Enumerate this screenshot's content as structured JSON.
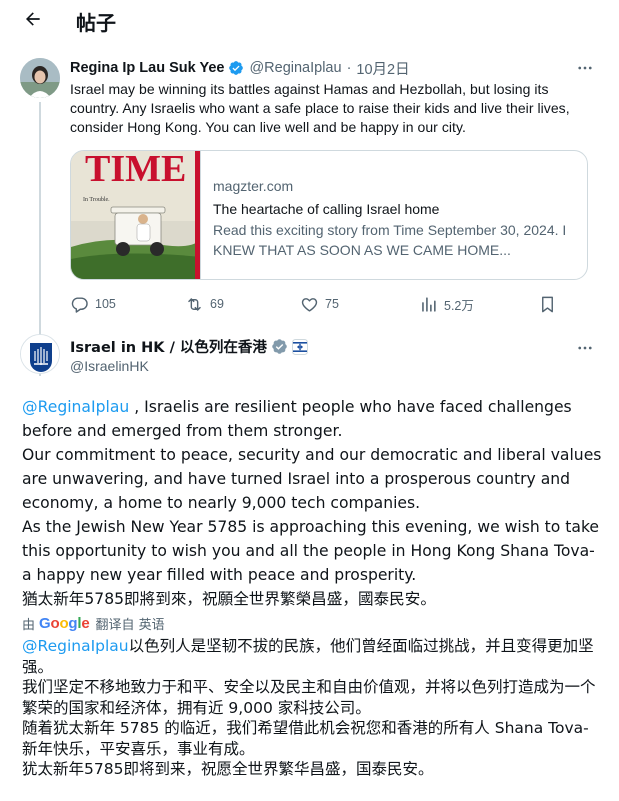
{
  "header": {
    "title": "帖子"
  },
  "tweet1": {
    "author_name": "Regina Ip Lau Suk Yee",
    "handle": "@ReginaIplau",
    "separator": "·",
    "date": "10月2日",
    "text": "Israel may be winning its battles against Hamas and Hezbollah, but losing its country. Any Israelis who want a safe place to raise their kids and live their lives, consider Hong Kong. You can live well and be happy in our city.",
    "card": {
      "thumb_masthead": "TIME",
      "thumb_caption": "In Trouble.",
      "domain": "magzter.com",
      "title": "The heartache of calling Israel home",
      "description": "Read this exciting story from Time September 30, 2024. I KNEW THAT AS SOON AS WE CAME HOME..."
    },
    "actions": {
      "replies": "105",
      "retweets": "69",
      "likes": "75",
      "views": "5.2万"
    }
  },
  "tweet2": {
    "author_name": "Israel in HK / 以色列在香港",
    "handle": "@IsraelinHK",
    "mention": "@ReginaIplau",
    "text_first": " , Israelis are resilient people who have faced challenges before and emerged from them stronger.",
    "paragraphs": [
      "Our commitment to peace, security and our democratic and liberal values are unwavering, and have turned Israel into a prosperous country and economy, a home to nearly 9,000 tech companies.",
      "As the Jewish New Year 5785 is approaching this evening, we wish to take this opportunity to wish you and all the people in Hong Kong Shana Tova- a happy new year filled with peace and prosperity.",
      "猶太新年5785即將到來，祝願全世界繁榮昌盛，國泰民安。"
    ],
    "translate": {
      "prefix": "由",
      "google": "Google",
      "label": "翻译自 英语"
    },
    "zh_mention": "@ReginaIplau",
    "zh_first": "以色列人是坚韧不拔的民族，他们曾经面临过挑战，并且变得更加坚强。",
    "zh_paragraphs": [
      "我们坚定不移地致力于和平、安全以及民主和自由价值观，并将以色列打造成为一个繁荣的国家和经济体，拥有近 9,000 家科技公司。",
      "随着犹太新年 5785 的临近，我们希望借此机会祝您和香港的所有人 Shana Tova- 新年快乐，平安喜乐，事业有成。",
      "犹太新年5785即将到来，祝愿全世界繁华昌盛，国泰民安。"
    ]
  },
  "colors": {
    "accent": "#1d9bf0",
    "text": "#0f1419",
    "secondary": "#536471",
    "border": "#cfd9de",
    "verified_blue": "#1d9bf0",
    "verified_gray": "#829aab"
  },
  "icons": [
    "back-arrow-icon",
    "verified-badge-icon",
    "more-icon",
    "reply-icon",
    "retweet-icon",
    "like-icon",
    "views-icon",
    "bookmark-icon",
    "emblem-icon",
    "flag-icon"
  ]
}
